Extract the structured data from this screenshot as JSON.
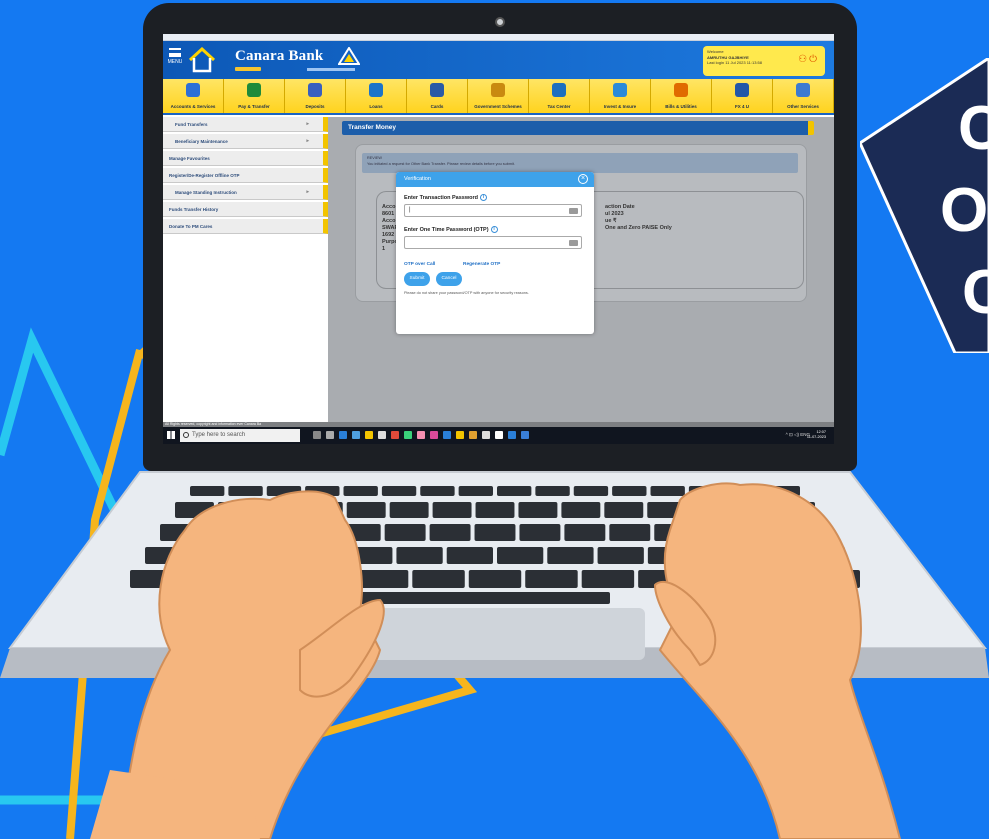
{
  "banner": {
    "lines": [
      "C",
      "O",
      "C"
    ]
  },
  "bank": {
    "name": "Canara Bank",
    "menu_label": "MENU",
    "welcome": {
      "greeting": "Welcome",
      "user": "AMRUTHU GAJBHIYE",
      "last_login": "Last login 11 Jul 2023 11:13:58"
    },
    "nav": [
      {
        "label": "Accounts & Services",
        "icon": "person-icon",
        "color": "#2e6fd6"
      },
      {
        "label": "Pay & Transfer",
        "icon": "transfer-arrows-icon",
        "color": "#1f8a3a"
      },
      {
        "label": "Deposits",
        "icon": "deposit-bag-icon",
        "color": "#3a5fbf"
      },
      {
        "label": "Loans",
        "icon": "house-loan-icon",
        "color": "#1d74c9"
      },
      {
        "label": "Cards",
        "icon": "card-icon",
        "color": "#2b5aa6"
      },
      {
        "label": "Government Schemes",
        "icon": "scheme-icon",
        "color": "#c98a10"
      },
      {
        "label": "Tax Center",
        "icon": "tax-icon",
        "color": "#1d6fbf"
      },
      {
        "label": "Invest & Insure",
        "icon": "invest-icon",
        "color": "#2a8ad8"
      },
      {
        "label": "Bills & Utilities",
        "icon": "bharat-billpay-icon",
        "color": "#e06b00"
      },
      {
        "label": "FX 4 U",
        "icon": "fx4u-icon",
        "color": "#2357a8"
      },
      {
        "label": "Other Services",
        "icon": "gear-icon",
        "color": "#3d7ad0"
      }
    ],
    "sidebar": [
      {
        "label": "Fund Transfers",
        "indent": true,
        "chevron": true
      },
      {
        "label": "Beneficiary Maintenance",
        "indent": true,
        "chevron": true
      },
      {
        "label": "Manage Favourites",
        "indent": false,
        "chevron": false
      },
      {
        "label": "Register/De-Register Offline OTP",
        "indent": false,
        "chevron": false
      },
      {
        "label": "Manage Standing Instruction",
        "indent": true,
        "chevron": true
      },
      {
        "label": "Funds Transfer History",
        "indent": false,
        "chevron": false
      },
      {
        "label": "Donate To PM Cares",
        "indent": false,
        "chevron": false
      }
    ],
    "page_title": "Transfer Money",
    "review": {
      "heading": "REVIEW",
      "text": "You initiated a request for Other Bank Transfer. Please review details before you submit."
    },
    "behind": {
      "col1": [
        "Acco",
        "8601",
        "Acco",
        "SWAP",
        "1692",
        "Purpo",
        "1"
      ],
      "col2": [
        "action Date",
        "ul 2023",
        "ue ₹",
        "One and Zero PAISE Only"
      ]
    },
    "modal": {
      "title": "Verification",
      "close": "×",
      "password_label": "Enter Transaction Password",
      "password_value": "|",
      "otp_label": "Enter One Time Password (OTP)",
      "otp_value": "",
      "otp_call": "OTP over Call",
      "regenerate": "Regenerate OTP",
      "submit": "Submit",
      "cancel": "Cancel",
      "note": "Please do not share your password/OTP with anyone for security reasons."
    },
    "status_bar": "All Rights reserved, copyright and information ever Canara Ba",
    "taskbar": {
      "search": "Type here to search",
      "tray": "^ ⊡ ◁) ENG",
      "time": "12:07",
      "date": "11-07-2023"
    }
  }
}
